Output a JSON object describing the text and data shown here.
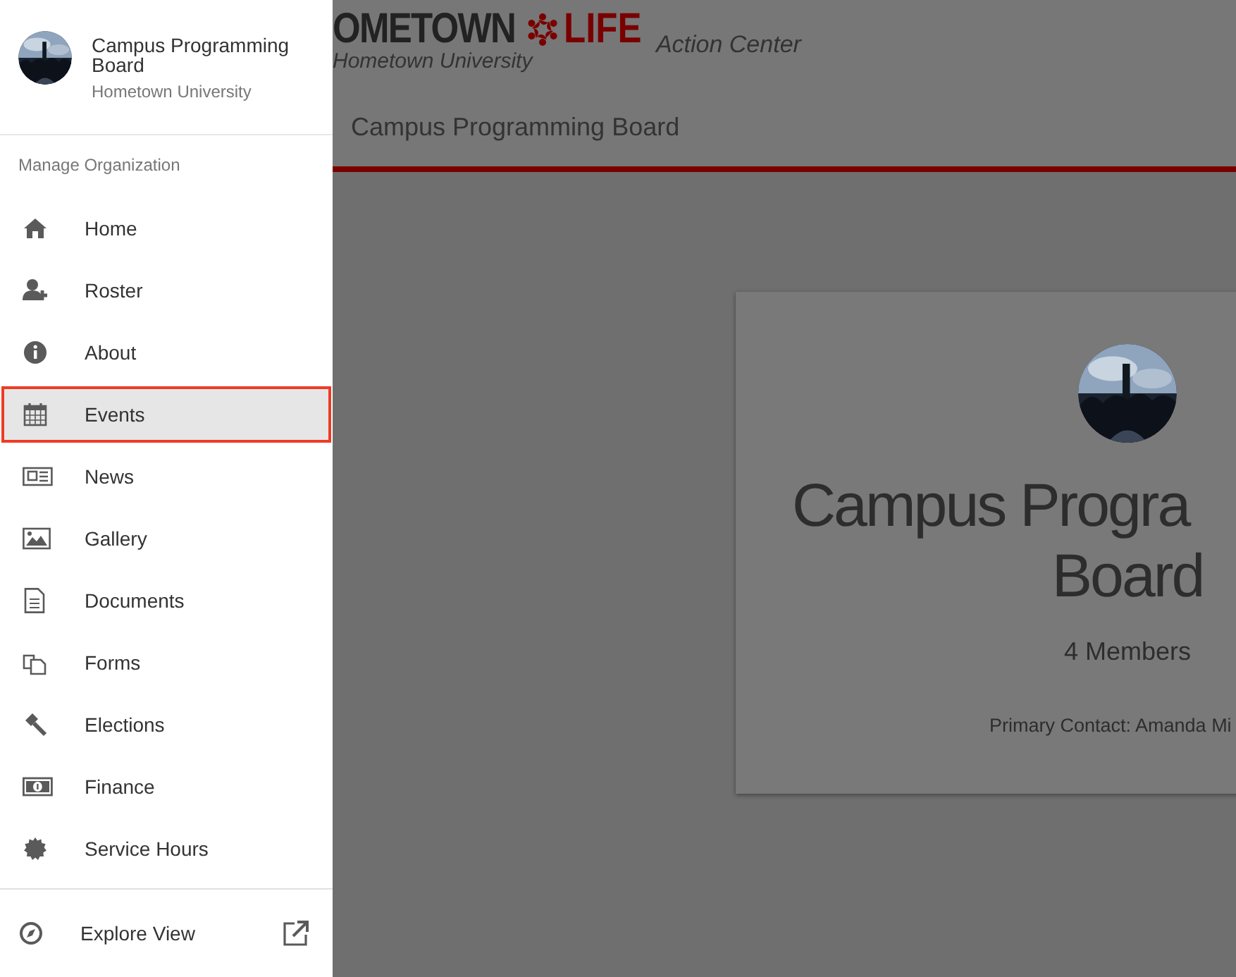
{
  "sidebar": {
    "org_name": "Campus Programming Board",
    "org_school": "Hometown University",
    "section_label": "Manage Organization",
    "items": [
      {
        "label": "Home",
        "selected": false
      },
      {
        "label": "Roster",
        "selected": false
      },
      {
        "label": "About",
        "selected": false
      },
      {
        "label": "Events",
        "selected": true
      },
      {
        "label": "News",
        "selected": false
      },
      {
        "label": "Gallery",
        "selected": false
      },
      {
        "label": "Documents",
        "selected": false
      },
      {
        "label": "Forms",
        "selected": false
      },
      {
        "label": "Elections",
        "selected": false
      },
      {
        "label": "Finance",
        "selected": false
      },
      {
        "label": "Service Hours",
        "selected": false
      }
    ],
    "footer_item": {
      "label": "Explore View"
    }
  },
  "header": {
    "logo_left": "OMETOWN",
    "logo_right": "LIFE",
    "logo_sub": "Hometown University",
    "app_name": "Action Center",
    "page_title": "Campus Programming Board"
  },
  "card": {
    "title_lines": [
      "Campus Progra",
      "Board"
    ],
    "members": "4 Members",
    "contact": "Primary Contact: Amanda Mi"
  }
}
